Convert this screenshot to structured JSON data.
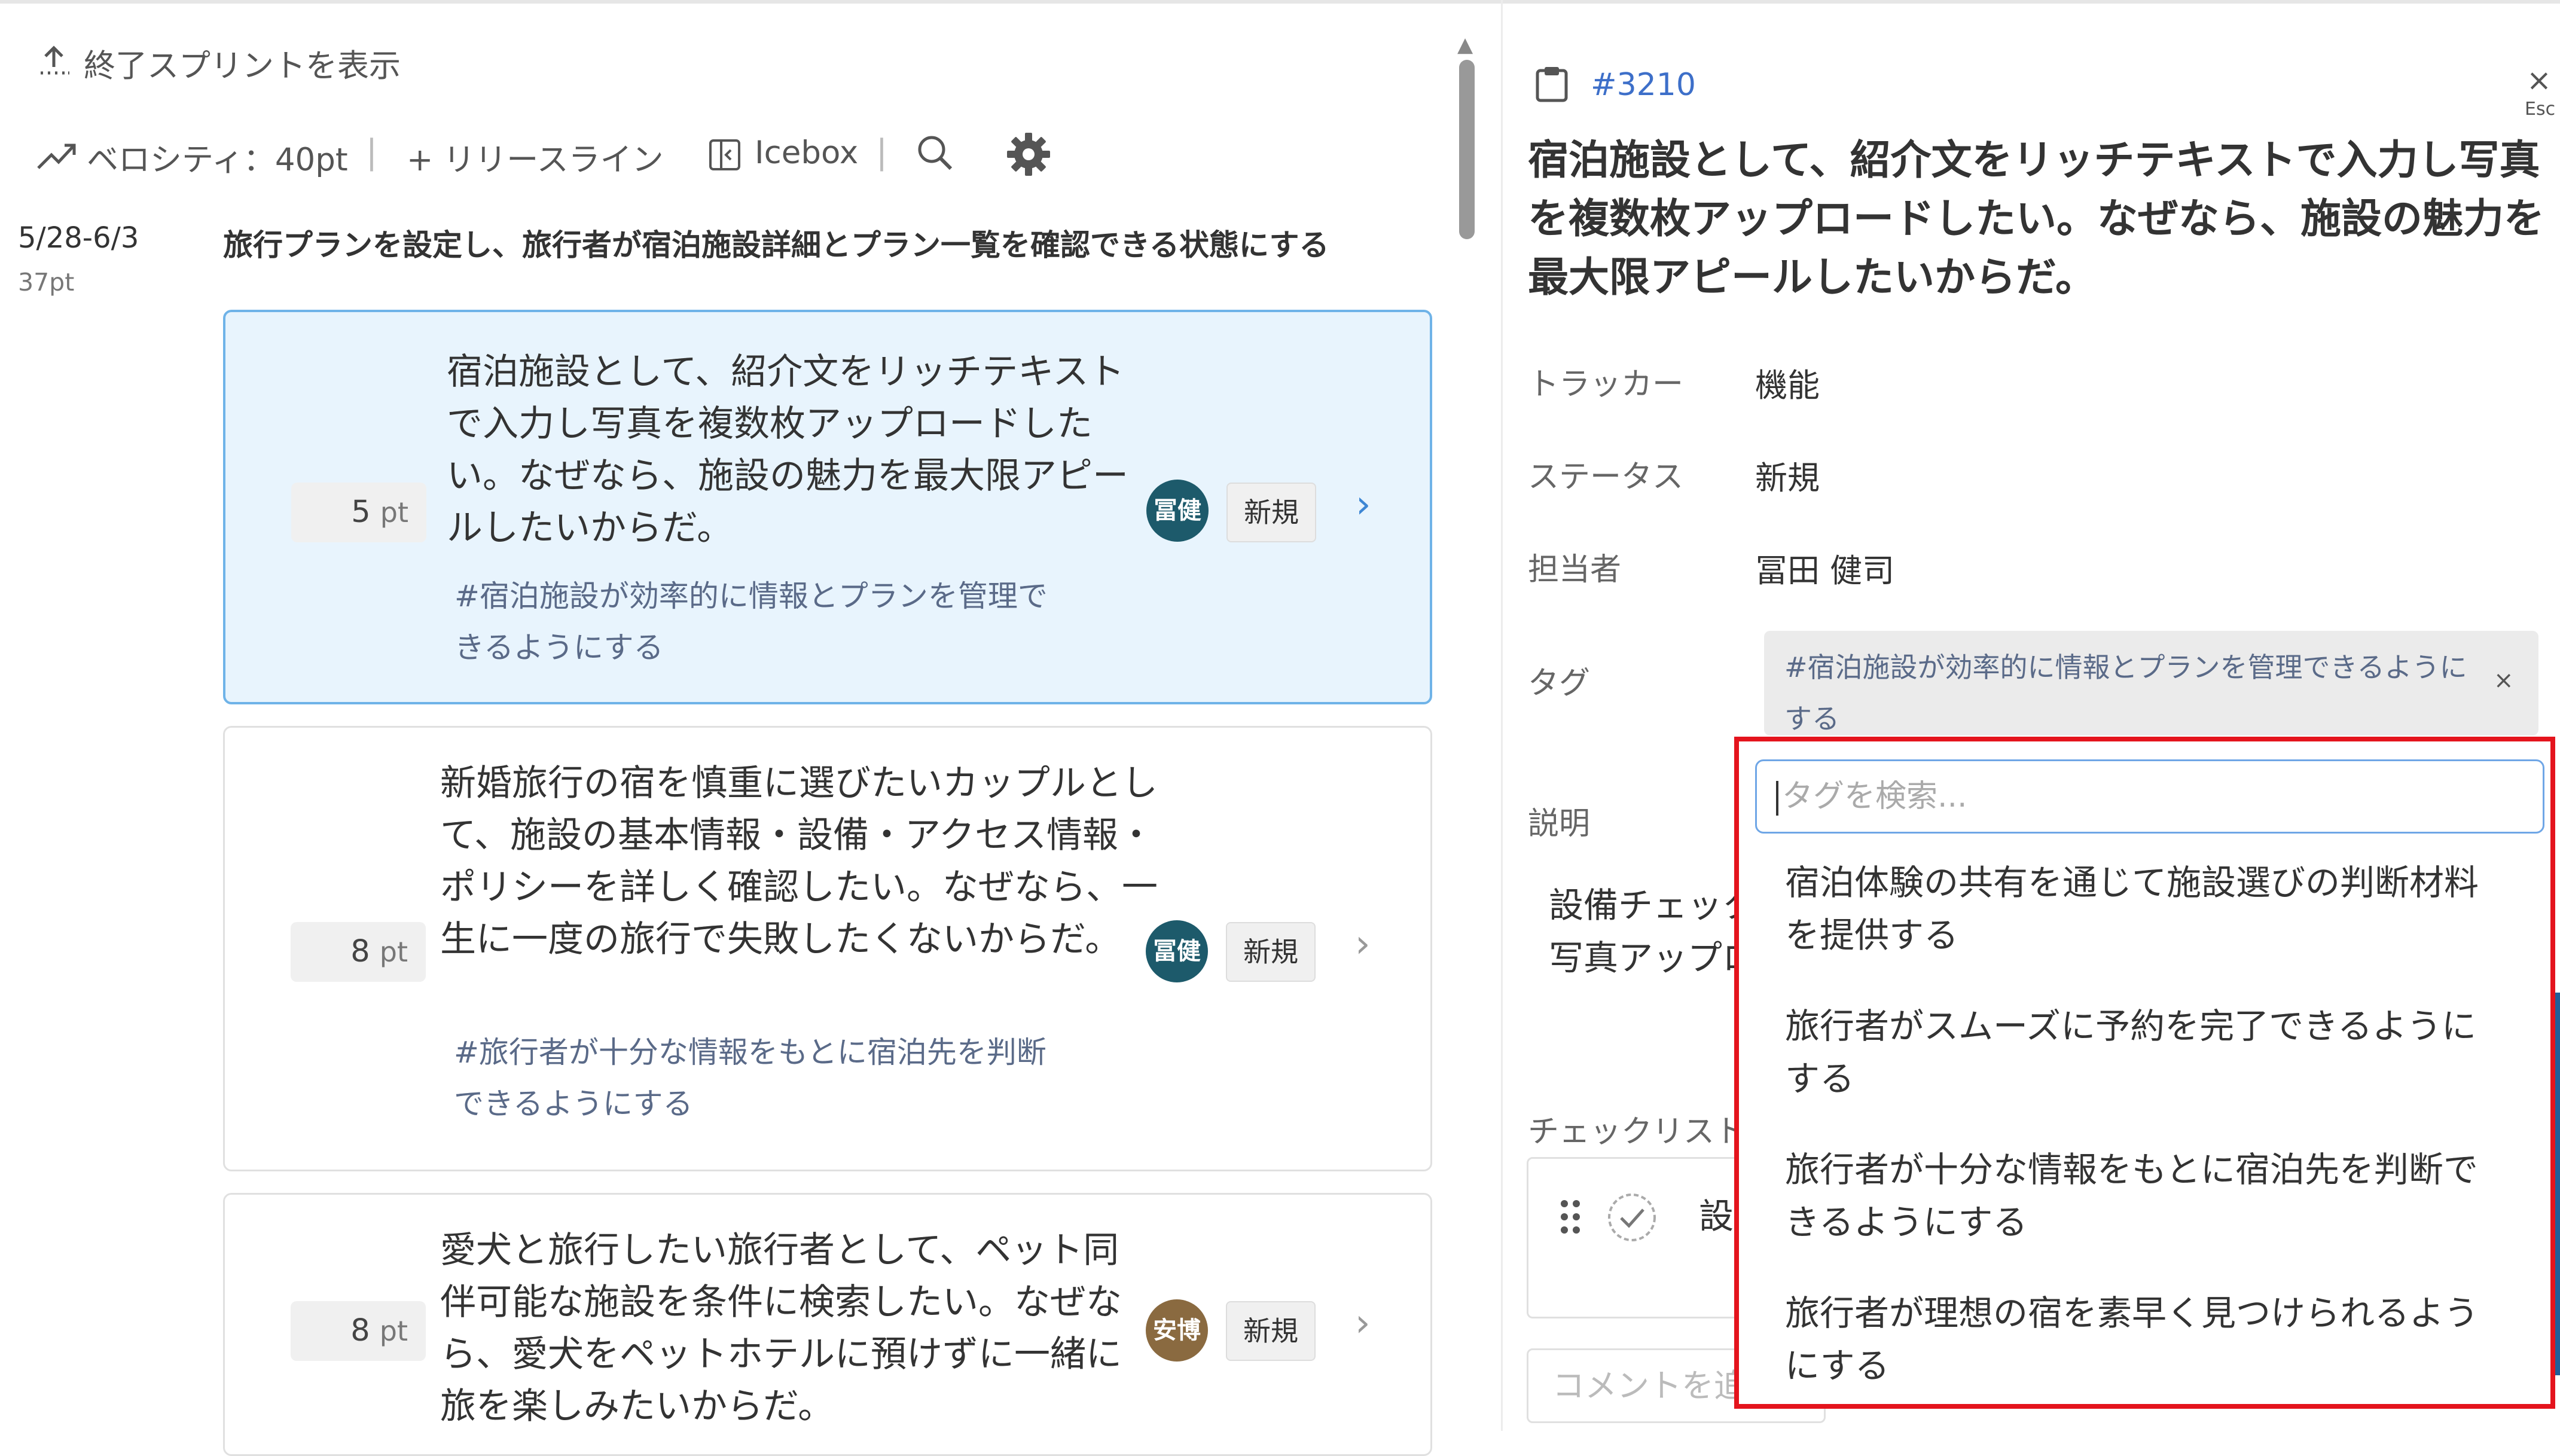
{
  "toolbar": {
    "show_finished_label": "終了スプリントを表示",
    "velocity_label": "ベロシティ：40pt",
    "release_line_label": "+ リリースライン",
    "icebox_label": "Icebox",
    "separator": "|"
  },
  "sprint": {
    "dates": "5/28-6/3",
    "points": "37pt",
    "goal": "旅行プランを設定し、旅行者が宿泊施設詳細とプラン一覧を確認できる状態にする"
  },
  "cards": [
    {
      "points": "5",
      "unit": "pt",
      "title": "宿泊施設として、紹介文をリッチテキストで入力し写真を複数枚アップロードしたい。なぜなら、施設の魅力を最大限アピールしたいからだ。",
      "tag": "#宿泊施設が効率的に情報とプランを管理できるようにする",
      "assignee_initials": "冨健",
      "avatar_color": "#1d5a6b",
      "status": "新規",
      "chevron": "›"
    },
    {
      "points": "8",
      "unit": "pt",
      "title": "新婚旅行の宿を慎重に選びたいカップルとして、施設の基本情報・設備・アクセス情報・ポリシーを詳しく確認したい。なぜなら、一生に一度の旅行で失敗したくないからだ。",
      "tag": "#旅行者が十分な情報をもとに宿泊先を判断できるようにする",
      "assignee_initials": "冨健",
      "avatar_color": "#1d5a6b",
      "status": "新規",
      "chevron": "›"
    },
    {
      "points": "8",
      "unit": "pt",
      "title": "愛犬と旅行したい旅行者として、ペット同伴可能な施設を条件に検索したい。なぜなら、愛犬をペットホテルに預けずに一緒に旅を楽しみたいからだ。",
      "tag": "",
      "assignee_initials": "安博",
      "avatar_color": "#8a6a40",
      "status": "新規",
      "chevron": "›"
    }
  ],
  "detail": {
    "ticket_id": "#3210",
    "close_label": "×",
    "esc_label": "Esc",
    "title": "宿泊施設として、紹介文をリッチテキストで入力し写真を複数枚アップロードしたい。なぜなら、施設の魅力を最大限アピールしたいからだ。",
    "fields": {
      "tracker_label": "トラッカー",
      "tracker_value": "機能",
      "status_label": "ステータス",
      "status_value": "新規",
      "assignee_label": "担当者",
      "assignee_value": "冨田 健司",
      "tag_label": "タグ",
      "tag_value": "#宿泊施設が効率的に情報とプランを管理できるようにする",
      "tag_remove": "×",
      "description_label": "説明"
    },
    "description_visible": [
      "設備チェック",
      "写真アップロ"
    ],
    "checklist_label": "チェックリスト",
    "checklist_item_visible": "設備",
    "comment_placeholder": "コメントを追"
  },
  "tag_dropdown": {
    "search_placeholder": "タグを検索...",
    "options": [
      "宿泊体験の共有を通じて施設選びの判断材料を提供する",
      "旅行者がスムーズに予約を完了できるようにする",
      "旅行者が十分な情報をもとに宿泊先を判断できるようにする",
      "旅行者が理想の宿を素早く見つけられるようにする"
    ],
    "highlight_color": "#e4141d"
  },
  "colors": {
    "selected_card_bg": "#e8f4fd",
    "selected_card_border": "#6fb3e8",
    "link_blue": "#3d6fc9"
  }
}
